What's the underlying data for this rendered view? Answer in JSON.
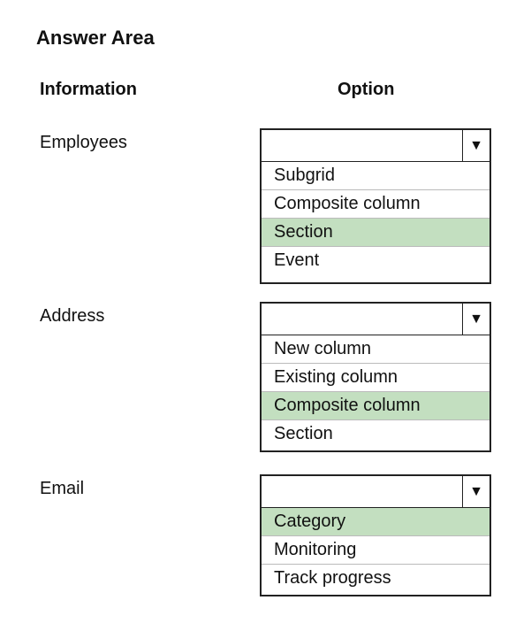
{
  "title": "Answer Area",
  "headers": {
    "information": "Information",
    "option": "Option"
  },
  "colors": {
    "selected": "#c3dfc0"
  },
  "rows": [
    {
      "label": "Employees",
      "options": [
        "Subgrid",
        "Composite column",
        "Section",
        "Event"
      ],
      "selected": "Section"
    },
    {
      "label": "Address",
      "options": [
        "New column",
        "Existing column",
        "Composite column",
        "Section"
      ],
      "selected": "Composite column"
    },
    {
      "label": "Email",
      "options": [
        "Category",
        "Monitoring",
        "Track progress"
      ],
      "selected": "Category"
    }
  ],
  "icons": {
    "dropdown": "▼"
  }
}
